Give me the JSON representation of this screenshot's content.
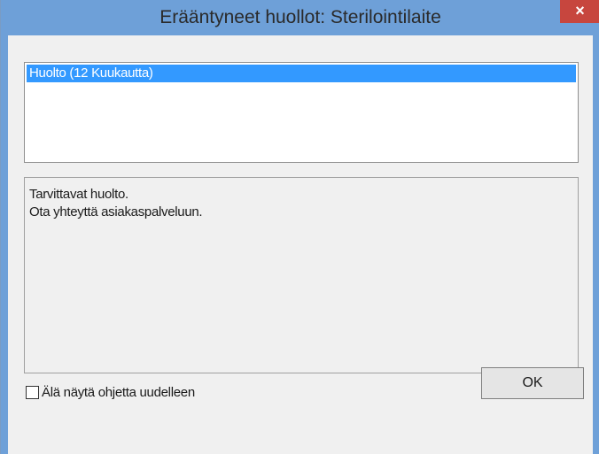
{
  "window": {
    "title": "Erääntyneet huollot: Sterilointilaite",
    "close_label": "×"
  },
  "list": {
    "items": [
      {
        "label": "Huolto (12 Kuukautta)",
        "selected": true
      }
    ]
  },
  "info": {
    "lines": [
      "Tarvittavat huolto.",
      "Ota yhteyttä asiakaspalveluun."
    ]
  },
  "checkbox": {
    "label": "Älä näytä ohjetta uudelleen",
    "checked": false
  },
  "buttons": {
    "ok_label": "OK"
  },
  "colors": {
    "titlebar": "#6ea0d8",
    "close": "#c7463e",
    "selection": "#3399ff"
  }
}
